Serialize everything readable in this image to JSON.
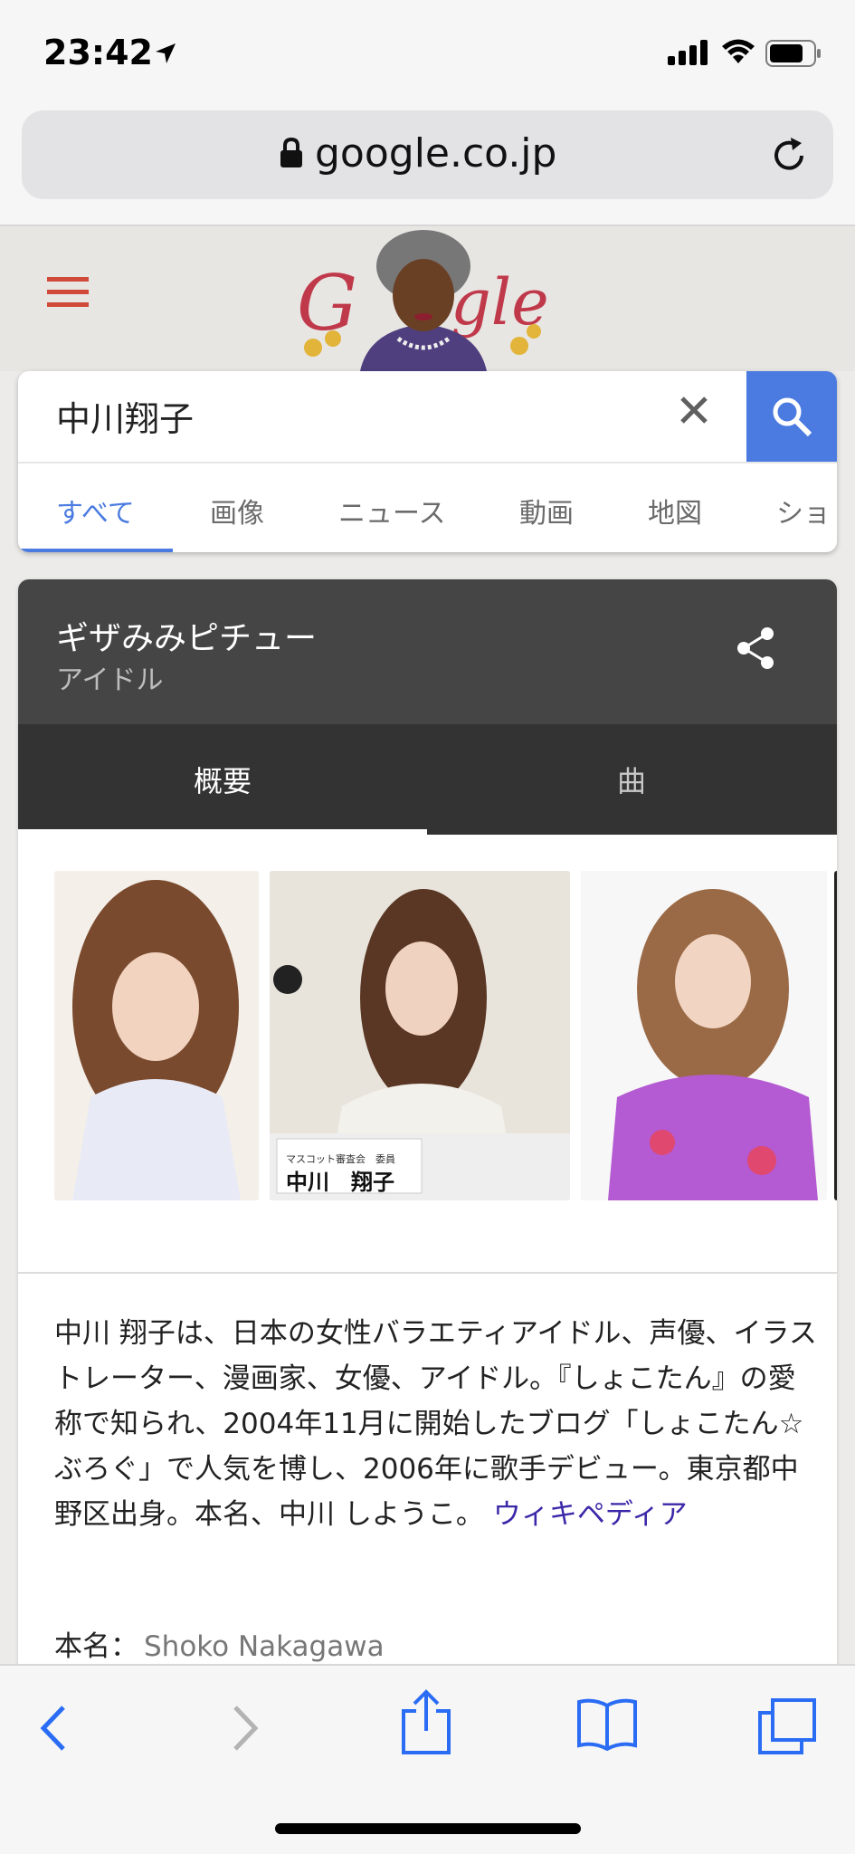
{
  "status_bar": {
    "time": "23:42"
  },
  "browser": {
    "url": "google.co.jp"
  },
  "search": {
    "query": "中川翔子",
    "tabs": [
      "すべて",
      "画像",
      "ニュース",
      "動画",
      "地図",
      "ショ"
    ]
  },
  "knowledge_panel": {
    "title": "ギザみみピチュー",
    "subtitle": "アイドル",
    "tabs": [
      "概要",
      "曲"
    ],
    "photo_caption": {
      "line1": "マスコット審査会　委員",
      "line2": "中川　翔子"
    },
    "description": "中川 翔子は、日本の女性バラエティアイドル、声優、イラストレーター、漫画家、女優、アイドル。『しょこたん』の愛称で知られ、2004年11月に開始したブログ「しょこたん☆ぶろぐ」で人気を博し、2006年に歌手デビュー。東京都中野区出身。本名、中川 しようこ。",
    "source": "ウィキペディア",
    "real_name_label": "本名：",
    "real_name_value": "Shoko Nakagawa"
  },
  "colors": {
    "accent": "#4b7be0",
    "panel_header": "#454545",
    "panel_tabs": "#333333",
    "link": "#3b28a8"
  }
}
